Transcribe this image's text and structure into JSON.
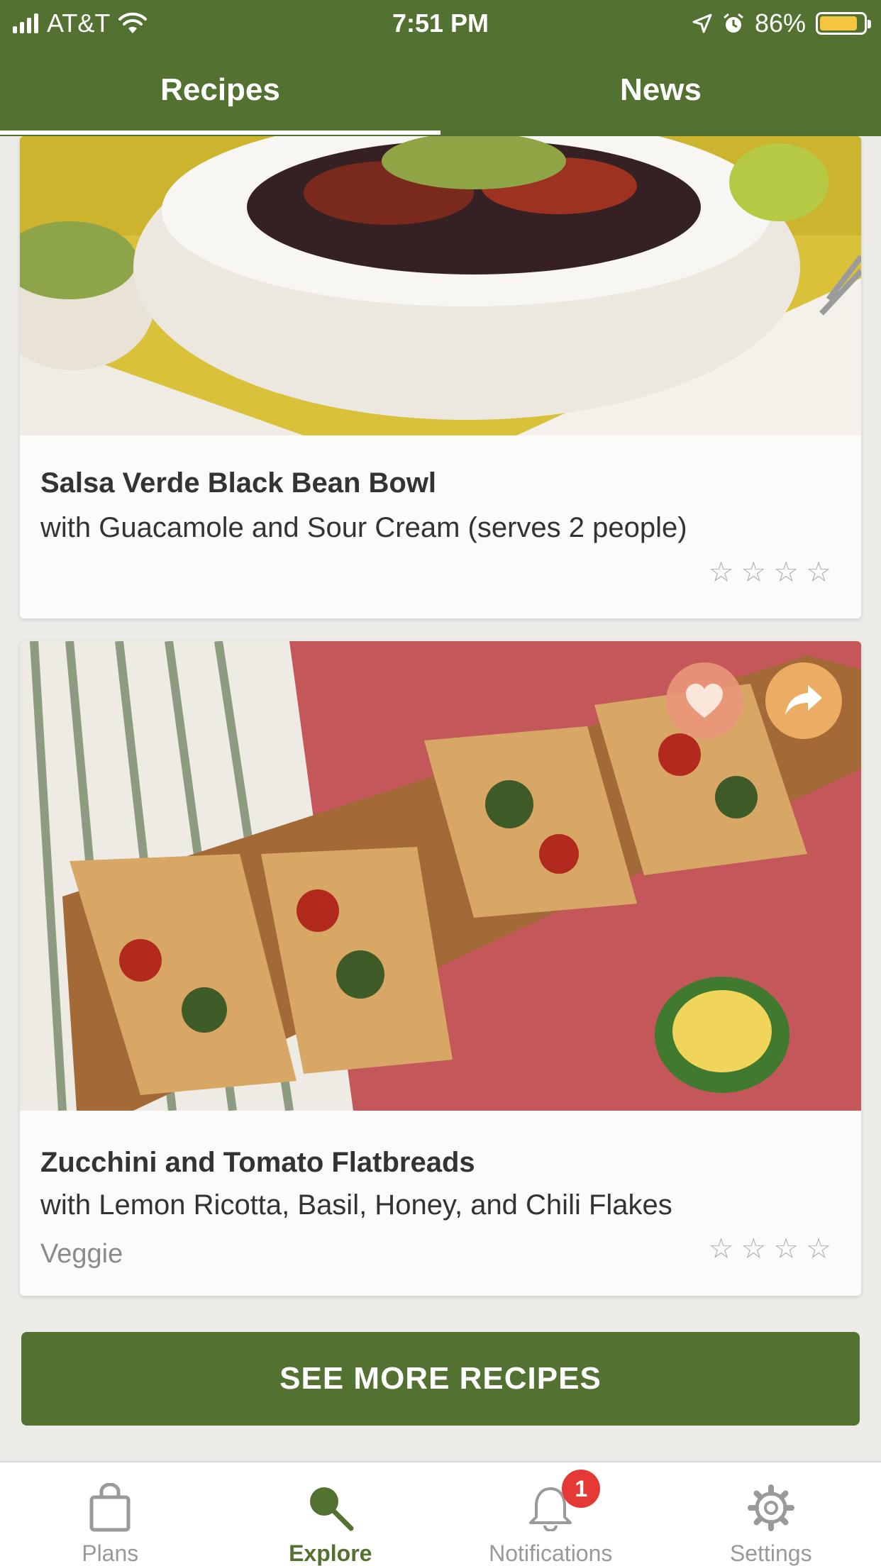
{
  "status_bar": {
    "carrier": "AT&T",
    "time": "7:51 PM",
    "battery": "86%",
    "battery_level": 0.86,
    "icons": [
      "signal-icon",
      "wifi-icon",
      "location-icon",
      "alarm-icon",
      "battery-icon"
    ]
  },
  "tabs": [
    {
      "label": "Recipes",
      "active": true
    },
    {
      "label": "News",
      "active": false
    }
  ],
  "recipes": [
    {
      "title": "Salsa Verde Black Bean Bowl",
      "subtitle": "with Guacamole and Sour Cream (serves 2 people)",
      "tag": "",
      "stars": [
        "☆",
        "☆",
        "☆",
        "☆"
      ]
    },
    {
      "title": "Zucchini and Tomato Flatbreads",
      "subtitle": "with Lemon Ricotta, Basil, Honey, and Chili Flakes",
      "tag": "Veggie",
      "stars": [
        "☆",
        "☆",
        "☆",
        "☆"
      ]
    }
  ],
  "see_more_label": "SEE MORE RECIPES",
  "bottom_nav": [
    {
      "label": "Plans",
      "icon": "bag-icon"
    },
    {
      "label": "Explore",
      "icon": "search-icon",
      "active": true
    },
    {
      "label": "Notifications",
      "icon": "bell-icon",
      "badge": "1"
    },
    {
      "label": "Settings",
      "icon": "gear-icon"
    }
  ],
  "colors": {
    "primary": "#537131",
    "badge": "#e53935",
    "favorite_button": "#e89678",
    "share_button": "#f3b267"
  }
}
